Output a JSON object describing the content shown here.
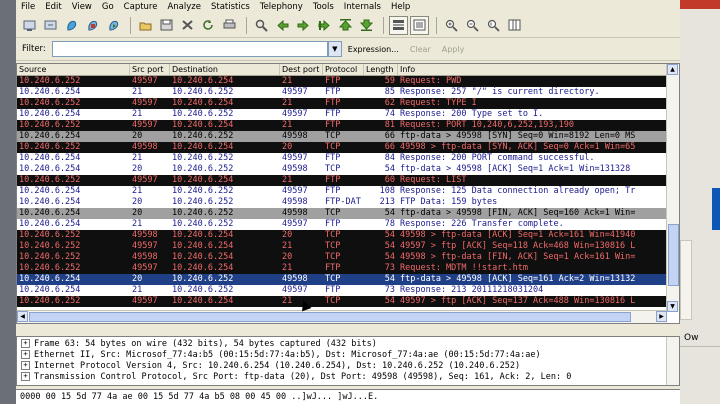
{
  "menu": [
    "File",
    "Edit",
    "View",
    "Go",
    "Capture",
    "Analyze",
    "Statistics",
    "Telephony",
    "Tools",
    "Internals",
    "Help"
  ],
  "toolbar_icons": [
    "list-interfaces-icon",
    "capture-options-icon",
    "start-capture-icon",
    "stop-capture-icon",
    "restart-capture-icon",
    "open-file-icon",
    "save-file-icon",
    "close-file-icon",
    "reload-icon",
    "print-icon",
    "find-packet-icon",
    "go-back-icon",
    "go-forward-icon",
    "go-to-packet-icon",
    "go-first-icon",
    "go-last-icon",
    "colorize-icon",
    "autoscroll-icon",
    "zoom-in-icon",
    "zoom-out-icon",
    "normal-size-icon",
    "resize-columns-icon"
  ],
  "filter": {
    "label": "Filter:",
    "value": "",
    "expression": "Expression...",
    "clear": "Clear",
    "apply": "Apply"
  },
  "columns": [
    "Source",
    "Src port",
    "Destination",
    "Dest port",
    "Protocol",
    "Length",
    "Info"
  ],
  "colors": {
    "ftp_bg": "#ffffff",
    "ftp_fg": "#1a1a8f",
    "dark_bg": "#0f0f0f",
    "dark_fg": "#f06a6a",
    "gray_bg": "#a0a0a0",
    "gray_fg": "#000000",
    "selected_bg": "#1f3f87",
    "selected_fg": "#ffffff"
  },
  "packets": [
    {
      "style": "dark",
      "src": "10.240.6.252",
      "sport": "49597",
      "dst": "10.240.6.254",
      "dport": "21",
      "proto": "FTP",
      "len": "59",
      "info": "Request: PWD"
    },
    {
      "style": "white",
      "src": "10.240.6.254",
      "sport": "21",
      "dst": "10.240.6.252",
      "dport": "49597",
      "proto": "FTP",
      "len": "85",
      "info": "Response: 257 \"/\" is current directory."
    },
    {
      "style": "dark",
      "src": "10.240.6.252",
      "sport": "49597",
      "dst": "10.240.6.254",
      "dport": "21",
      "proto": "FTP",
      "len": "62",
      "info": "Request: TYPE I"
    },
    {
      "style": "white",
      "src": "10.240.6.254",
      "sport": "21",
      "dst": "10.240.6.252",
      "dport": "49597",
      "proto": "FTP",
      "len": "74",
      "info": "Response: 200 Type set to I."
    },
    {
      "style": "dark",
      "src": "10.240.6.252",
      "sport": "49597",
      "dst": "10.240.6.254",
      "dport": "21",
      "proto": "FTP",
      "len": "81",
      "info": "Request: PORT 10,240,6,252,193,190"
    },
    {
      "style": "gray",
      "src": "10.240.6.254",
      "sport": "20",
      "dst": "10.240.6.252",
      "dport": "49598",
      "proto": "TCP",
      "len": "66",
      "info": "ftp-data > 49598 [SYN] Seq=0 Win=8192 Len=0 MS"
    },
    {
      "style": "dark",
      "src": "10.240.6.252",
      "sport": "49598",
      "dst": "10.240.6.254",
      "dport": "20",
      "proto": "TCP",
      "len": "66",
      "info": "49598 > ftp-data [SYN, ACK] Seq=0 Ack=1 Win=65"
    },
    {
      "style": "white",
      "src": "10.240.6.254",
      "sport": "21",
      "dst": "10.240.6.252",
      "dport": "49597",
      "proto": "FTP",
      "len": "84",
      "info": "Response: 200 PORT command successful."
    },
    {
      "style": "white",
      "src": "10.240.6.254",
      "sport": "20",
      "dst": "10.240.6.252",
      "dport": "49598",
      "proto": "TCP",
      "len": "54",
      "info": "ftp-data > 49598 [ACK] Seq=1 Ack=1 Win=131328"
    },
    {
      "style": "dark",
      "src": "10.240.6.252",
      "sport": "49597",
      "dst": "10.240.6.254",
      "dport": "21",
      "proto": "FTP",
      "len": "60",
      "info": "Request: LIST"
    },
    {
      "style": "white",
      "src": "10.240.6.254",
      "sport": "21",
      "dst": "10.240.6.252",
      "dport": "49597",
      "proto": "FTP",
      "len": "108",
      "info": "Response: 125 Data connection already open; Tr"
    },
    {
      "style": "white",
      "src": "10.240.6.254",
      "sport": "20",
      "dst": "10.240.6.252",
      "dport": "49598",
      "proto": "FTP-DAT",
      "len": "213",
      "info": "FTP Data: 159 bytes"
    },
    {
      "style": "gray",
      "src": "10.240.6.254",
      "sport": "20",
      "dst": "10.240.6.252",
      "dport": "49598",
      "proto": "TCP",
      "len": "54",
      "info": "ftp-data > 49598 [FIN, ACK] Seq=160 Ack=1 Win="
    },
    {
      "style": "white",
      "src": "10.240.6.254",
      "sport": "21",
      "dst": "10.240.6.252",
      "dport": "49597",
      "proto": "FTP",
      "len": "78",
      "info": "Response: 226 Transfer complete."
    },
    {
      "style": "dark",
      "src": "10.240.6.252",
      "sport": "49598",
      "dst": "10.240.6.254",
      "dport": "20",
      "proto": "TCP",
      "len": "54",
      "info": "49598 > ftp-data [ACK] Seq=1 Ack=161 Win=41940"
    },
    {
      "style": "dark",
      "src": "10.240.6.252",
      "sport": "49597",
      "dst": "10.240.6.254",
      "dport": "21",
      "proto": "TCP",
      "len": "54",
      "info": "49597 > ftp [ACK] Seq=118 Ack=468 Win=130816 L"
    },
    {
      "style": "dark",
      "src": "10.240.6.252",
      "sport": "49598",
      "dst": "10.240.6.254",
      "dport": "20",
      "proto": "TCP",
      "len": "54",
      "info": "49598 > ftp-data [FIN, ACK] Seq=1 Ack=161 Win="
    },
    {
      "style": "dark",
      "src": "10.240.6.252",
      "sport": "49597",
      "dst": "10.240.6.254",
      "dport": "21",
      "proto": "FTP",
      "len": "73",
      "info": "Request: MDTM !!start.htm"
    },
    {
      "style": "selected",
      "src": "10.240.6.254",
      "sport": "20",
      "dst": "10.240.6.252",
      "dport": "49598",
      "proto": "TCP",
      "len": "54",
      "info": "ftp-data > 49598 [ACK] Seq=161 Ack=2 Win=13132"
    },
    {
      "style": "white",
      "src": "10.240.6.254",
      "sport": "21",
      "dst": "10.240.6.252",
      "dport": "49597",
      "proto": "FTP",
      "len": "73",
      "info": "Response: 213 20111218031204"
    },
    {
      "style": "dark",
      "src": "10.240.6.252",
      "sport": "49597",
      "dst": "10.240.6.254",
      "dport": "21",
      "proto": "TCP",
      "len": "54",
      "info": "49597 > ftp [ACK] Seq=137 Ack=488 Win=130816 L"
    }
  ],
  "details": [
    "Frame 63: 54 bytes on wire (432 bits), 54 bytes captured (432 bits)",
    "Ethernet II, Src: Microsof_77:4a:b5 (00:15:5d:77:4a:b5), Dst: Microsof_77:4a:ae (00:15:5d:77:4a:ae)",
    "Internet Protocol Version 4, Src: 10.240.6.254 (10.240.6.254), Dst: 10.240.6.252 (10.240.6.252)",
    "Transmission Control Protocol, Src Port: ftp-data (20), Dst Port: 49598 (49598), Seq: 161, Ack: 2, Len: 0"
  ],
  "hex_line": "0000  00 15 5d 77 4a ae 00 15  5d 77 4a b5 08 00 45 00   ..]wJ... ]wJ...E.",
  "right_panel_tab": "Ow"
}
